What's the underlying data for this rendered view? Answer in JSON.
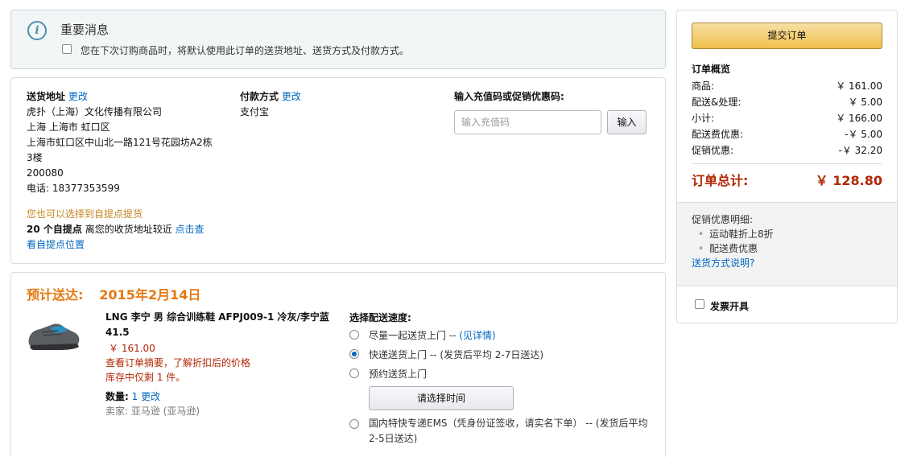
{
  "notice": {
    "icon_glyph": "i",
    "title": "重要消息",
    "checkbox_label": "您在下次订购商品时，将默认使用此订单的送货地址、送货方式及付款方式。"
  },
  "shipping": {
    "heading": "送货地址",
    "change": "更改",
    "lines": [
      "虎扑（上海）文化传播有限公司",
      "上海 上海市 虹口区",
      "上海市虹口区中山北一路121号花园坊A2栋",
      "3楼",
      "200080",
      "电话: 18377353599"
    ]
  },
  "payment": {
    "heading": "付款方式",
    "change": "更改",
    "method": "支付宝"
  },
  "promo": {
    "heading": "输入充值码或促销优惠码:",
    "placeholder": "输入充值码",
    "button": "输入"
  },
  "pickup": {
    "hint": "您也可以选择到自提点提货",
    "count": "20 个自提点",
    "text": " 离您的收货地址较近 ",
    "link": "点击查看自提点位置"
  },
  "delivery": {
    "estimate_label": "预计送达:",
    "date": "2015年2月14日",
    "item": {
      "title": "LNG 李宁 男 综合训练鞋 AFPJ009-1 冷灰/李宁蓝 41.5",
      "price": "￥ 161.00",
      "note1": "查看订单摘要，了解折扣后的价格",
      "note2": "库存中仅剩 1 件。",
      "qty_label": "数量:",
      "qty_value": "1",
      "qty_change": "更改",
      "seller": "卖家: 亚马逊 (亚马逊)"
    },
    "speed_title": "选择配送速度:",
    "options": [
      {
        "label": "尽量一起送货上门 --",
        "extra": "(见详情)",
        "selected": false
      },
      {
        "label": "快递送货上门 --",
        "extra": "(发货后平均 2-7日送达)",
        "selected": true
      },
      {
        "label": "预约送货上门",
        "extra": "",
        "selected": false
      },
      {
        "label": "国内特快专递EMS（凭身份证签收，请实名下单） -- (发货后平均 2-5日送达)",
        "extra": "",
        "selected": false
      }
    ],
    "time_button": "请选择时间"
  },
  "summary": {
    "submit": "提交订单",
    "title": "订单概览",
    "rows": [
      {
        "label": "商品:",
        "value": "￥ 161.00"
      },
      {
        "label": "配送&处理:",
        "value": "￥ 5.00"
      },
      {
        "label": "小计:",
        "value": "￥ 166.00"
      },
      {
        "label": "配送费优惠:",
        "value": "-￥ 5.00"
      },
      {
        "label": "促销优惠:",
        "value": "-￥ 32.20"
      }
    ],
    "total_label": "订单总计:",
    "total_value": "￥ 128.80",
    "promo_title": "促销优惠明细:",
    "promo_items": [
      "运动鞋折上8折",
      "配送费优惠"
    ],
    "shipping_link": "送货方式说明?",
    "invoice_label": "发票开具"
  },
  "colors": {
    "accent_orange": "#e47911",
    "price_red": "#b12704",
    "link_blue": "#0066c0",
    "button_yellow": "#f0c14b"
  }
}
